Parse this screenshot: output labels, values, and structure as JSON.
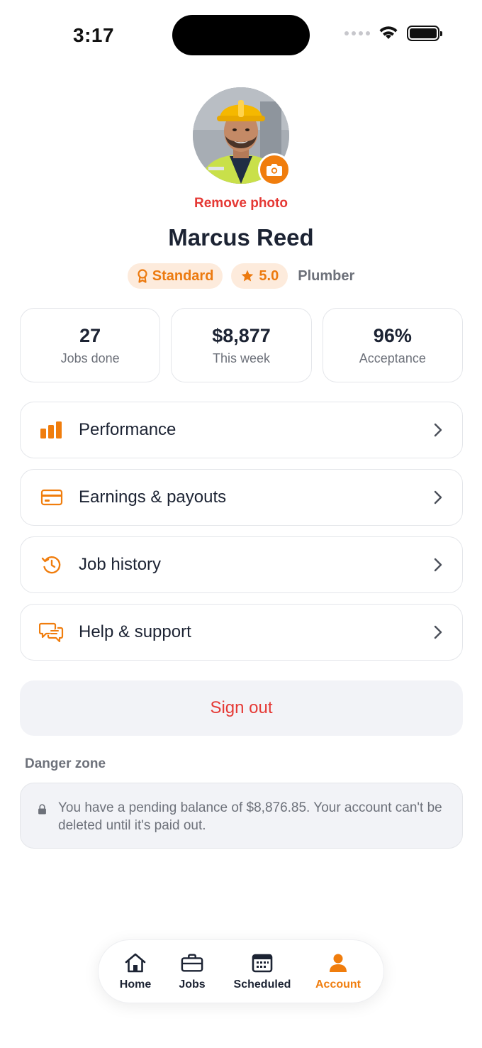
{
  "status_bar": {
    "time": "3:17"
  },
  "profile": {
    "remove_photo": "Remove photo",
    "name": "Marcus Reed",
    "tier_badge": "Standard",
    "rating": "5.0",
    "trade": "Plumber"
  },
  "stats": [
    {
      "value": "27",
      "label": "Jobs done"
    },
    {
      "value": "$8,877",
      "label": "This week"
    },
    {
      "value": "96%",
      "label": "Acceptance"
    }
  ],
  "menu": [
    {
      "label": "Performance",
      "icon": "bar-chart-icon"
    },
    {
      "label": "Earnings & payouts",
      "icon": "credit-card-icon"
    },
    {
      "label": "Job history",
      "icon": "history-icon"
    },
    {
      "label": "Help & support",
      "icon": "chat-bubbles-icon"
    }
  ],
  "sign_out": "Sign out",
  "danger_zone": {
    "title": "Danger zone",
    "message": "You have a pending balance of $8,876.85. Your account can't be deleted until it's paid out."
  },
  "tabs": [
    {
      "label": "Home",
      "icon": "home-icon",
      "active": false
    },
    {
      "label": "Jobs",
      "icon": "briefcase-icon",
      "active": false
    },
    {
      "label": "Scheduled",
      "icon": "calendar-icon",
      "active": false
    },
    {
      "label": "Account",
      "icon": "person-icon",
      "active": true
    }
  ],
  "colors": {
    "accent": "#f07d0d",
    "danger": "#e53935",
    "text": "#1c2333",
    "muted": "#6d717a"
  }
}
